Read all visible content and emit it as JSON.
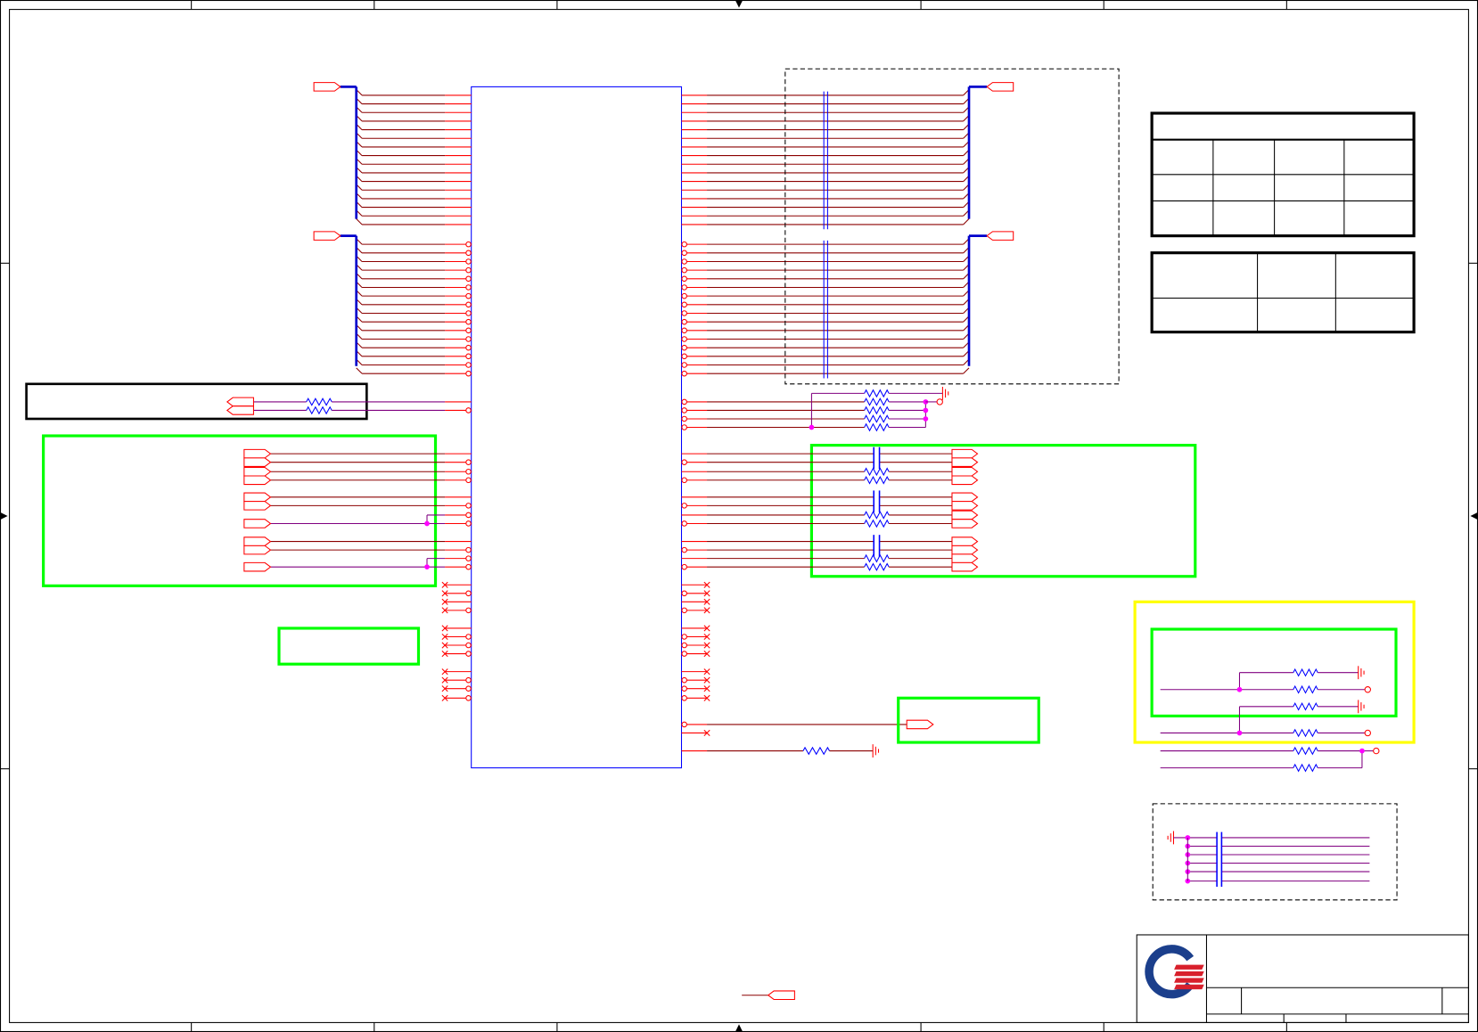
{
  "colors": {
    "background": "#ffffff",
    "frame": "#000000",
    "ic_outline": "#0000ff",
    "bus": "#0000cc",
    "pin": "#ff0000",
    "wire": "#8b0000",
    "net": "#800080",
    "junction": "#ff00ff",
    "passive": "#0000ff",
    "highlight_green": "#00ff00",
    "highlight_yellow": "#ffff00",
    "logo_blue": "#1b3f8c",
    "logo_red": "#d8202c"
  },
  "icons": {
    "logo": "company-logo-icon",
    "ground": "ground-icon",
    "resistor": "resistor-icon",
    "capacitor": "capacitor-icon",
    "connector": "off-page-connector-icon",
    "no_connect": "no-connect-mark"
  }
}
